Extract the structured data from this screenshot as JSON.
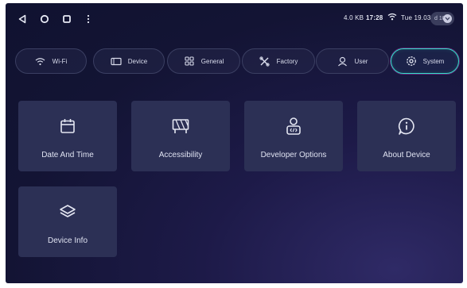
{
  "status_bar": {
    "nav_icons": [
      "back-icon",
      "home-icon",
      "recents-icon",
      "more-vert-icon"
    ],
    "net_speed": "4.0 KB",
    "time": "17:28",
    "date": "Tue 19.03",
    "battery_label": "d 10"
  },
  "tabs": [
    {
      "label": "Wi-Fi",
      "icon": "wifi-icon",
      "active": false
    },
    {
      "label": "Device",
      "icon": "device-icon",
      "active": false
    },
    {
      "label": "General",
      "icon": "grid-icon",
      "active": false
    },
    {
      "label": "Factory",
      "icon": "tools-icon",
      "active": false
    },
    {
      "label": "User",
      "icon": "user-icon",
      "active": false
    },
    {
      "label": "System",
      "icon": "gear-icon",
      "active": true
    }
  ],
  "tiles": [
    {
      "label": "Date And Time",
      "icon": "calendar-icon"
    },
    {
      "label": "Accessibility",
      "icon": "accessibility-icon"
    },
    {
      "label": "Developer Options",
      "icon": "developer-icon"
    },
    {
      "label": "About Device",
      "icon": "info-icon"
    },
    {
      "label": "Device Info",
      "icon": "layers-icon"
    }
  ],
  "colors": {
    "background": "#141634",
    "tile": "#2c3055",
    "active_border": "#2fe0c8",
    "active_glow": "#c83cc8",
    "text": "#e4e6f2"
  }
}
